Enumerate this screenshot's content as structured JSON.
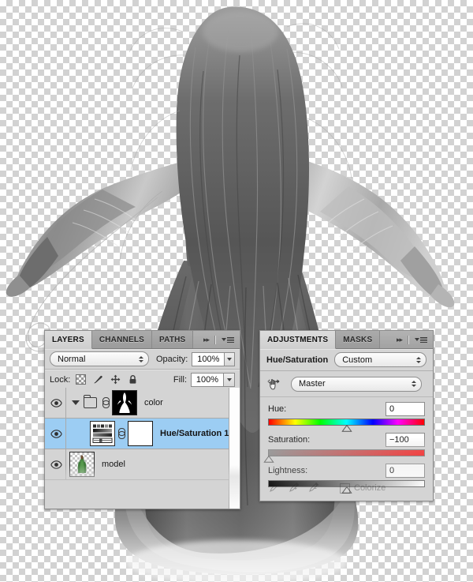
{
  "app": {
    "document_canvas": "transparent-checkerboard",
    "artwork_description": "grayscale photo of woman from behind with long hair and flowing gown"
  },
  "layers_panel": {
    "tabs": [
      {
        "label": "LAYERS",
        "active": true
      },
      {
        "label": "CHANNELS",
        "active": false
      },
      {
        "label": "PATHS",
        "active": false
      }
    ],
    "collapse_icon": "double-arrow-right-icon",
    "menu_icon": "panel-menu-icon",
    "blend_mode": "Normal",
    "opacity_label": "Opacity:",
    "opacity_value": "100%",
    "lock_label": "Lock:",
    "lock_icons": [
      "lock-transparency-icon",
      "lock-image-icon",
      "lock-position-icon",
      "lock-all-icon"
    ],
    "fill_label": "Fill:",
    "fill_value": "100%",
    "layers": [
      {
        "name": "color",
        "type": "group",
        "visible": true,
        "selected": false,
        "expanded": true,
        "linked": true,
        "thumb": "figure-mask-white-on-black"
      },
      {
        "name": "Hue/Saturation 1",
        "type": "adjustment",
        "visible": true,
        "selected": true,
        "linked": true,
        "thumb": "hue-saturation-adjustment-icon",
        "mask_thumb": "white-layer-mask"
      },
      {
        "name": "model",
        "type": "image",
        "visible": true,
        "selected": false,
        "linked": false,
        "thumb": "model-color-photo"
      }
    ]
  },
  "adjustments_panel": {
    "tabs": [
      {
        "label": "ADJUSTMENTS",
        "active": true
      },
      {
        "label": "MASKS",
        "active": false
      }
    ],
    "collapse_icon": "double-arrow-right-icon",
    "menu_icon": "panel-menu-icon",
    "title": "Hue/Saturation",
    "preset": "Custom",
    "targeted_adjustment_icon": "targeted-adjustment-tool-icon",
    "channel": "Master",
    "sliders": [
      {
        "name": "hue",
        "label": "Hue:",
        "value": "0",
        "numeric": 0,
        "min": -180,
        "max": 180,
        "gradient": "hue-spectrum"
      },
      {
        "name": "saturation",
        "label": "Saturation:",
        "value": "−100",
        "numeric": -100,
        "min": -100,
        "max": 100,
        "gradient": "gray-to-red"
      },
      {
        "name": "lightness",
        "label": "Lightness:",
        "value": "0",
        "numeric": 0,
        "min": -100,
        "max": 100,
        "gradient": "black-to-white"
      }
    ],
    "colorize_label": "Colorize",
    "colorize_checked": false,
    "eyedropper_icons": [
      "eyedropper-icon",
      "eyedropper-add-icon",
      "eyedropper-subtract-icon"
    ]
  },
  "colors": {
    "panel_bg": "#d4d4d4",
    "panel_border": "#8d8d8d",
    "tab_active_bg": "#dcdcdc",
    "tab_inactive_bg": "#a4a4a4",
    "selection_blue": "#9ccdf3",
    "checkerboard_light": "#ffffff",
    "checkerboard_dark": "#d2d2d2",
    "text": "#1b1b1b"
  }
}
